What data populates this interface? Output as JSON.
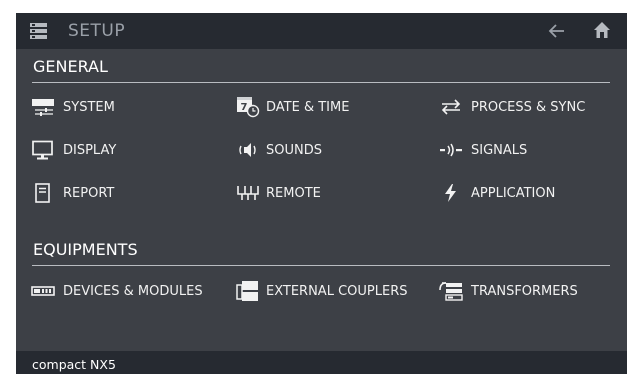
{
  "header": {
    "title": "SETUP",
    "logo_icon": "menu-stack-icon",
    "back_icon": "arrow-left-icon",
    "home_icon": "home-icon"
  },
  "general": {
    "title": "GENERAL",
    "items": [
      {
        "label": "SYSTEM",
        "icon": "system-settings-icon"
      },
      {
        "label": "DATE & TIME",
        "icon": "calendar-clock-icon"
      },
      {
        "label": "PROCESS & SYNC",
        "icon": "swap-arrows-icon"
      },
      {
        "label": "DISPLAY",
        "icon": "monitor-icon"
      },
      {
        "label": "SOUNDS",
        "icon": "speaker-icon"
      },
      {
        "label": "SIGNALS",
        "icon": "signal-icon"
      },
      {
        "label": "REPORT",
        "icon": "document-icon"
      },
      {
        "label": "REMOTE",
        "icon": "terminal-block-icon"
      },
      {
        "label": "APPLICATION",
        "icon": "lightning-icon"
      }
    ]
  },
  "equipments": {
    "title": "EQUIPMENTS",
    "items": [
      {
        "label": "DEVICES & MODULES",
        "icon": "module-icon"
      },
      {
        "label": "EXTERNAL COUPLERS",
        "icon": "coupler-icon"
      },
      {
        "label": "TRANSFORMERS",
        "icon": "transformer-icon"
      }
    ]
  },
  "footer": {
    "device": "compact NX5"
  },
  "colors": {
    "background": "#3d4046",
    "header": "#262a31",
    "text": "#f2f2f2",
    "muted": "#9aa0a8"
  }
}
